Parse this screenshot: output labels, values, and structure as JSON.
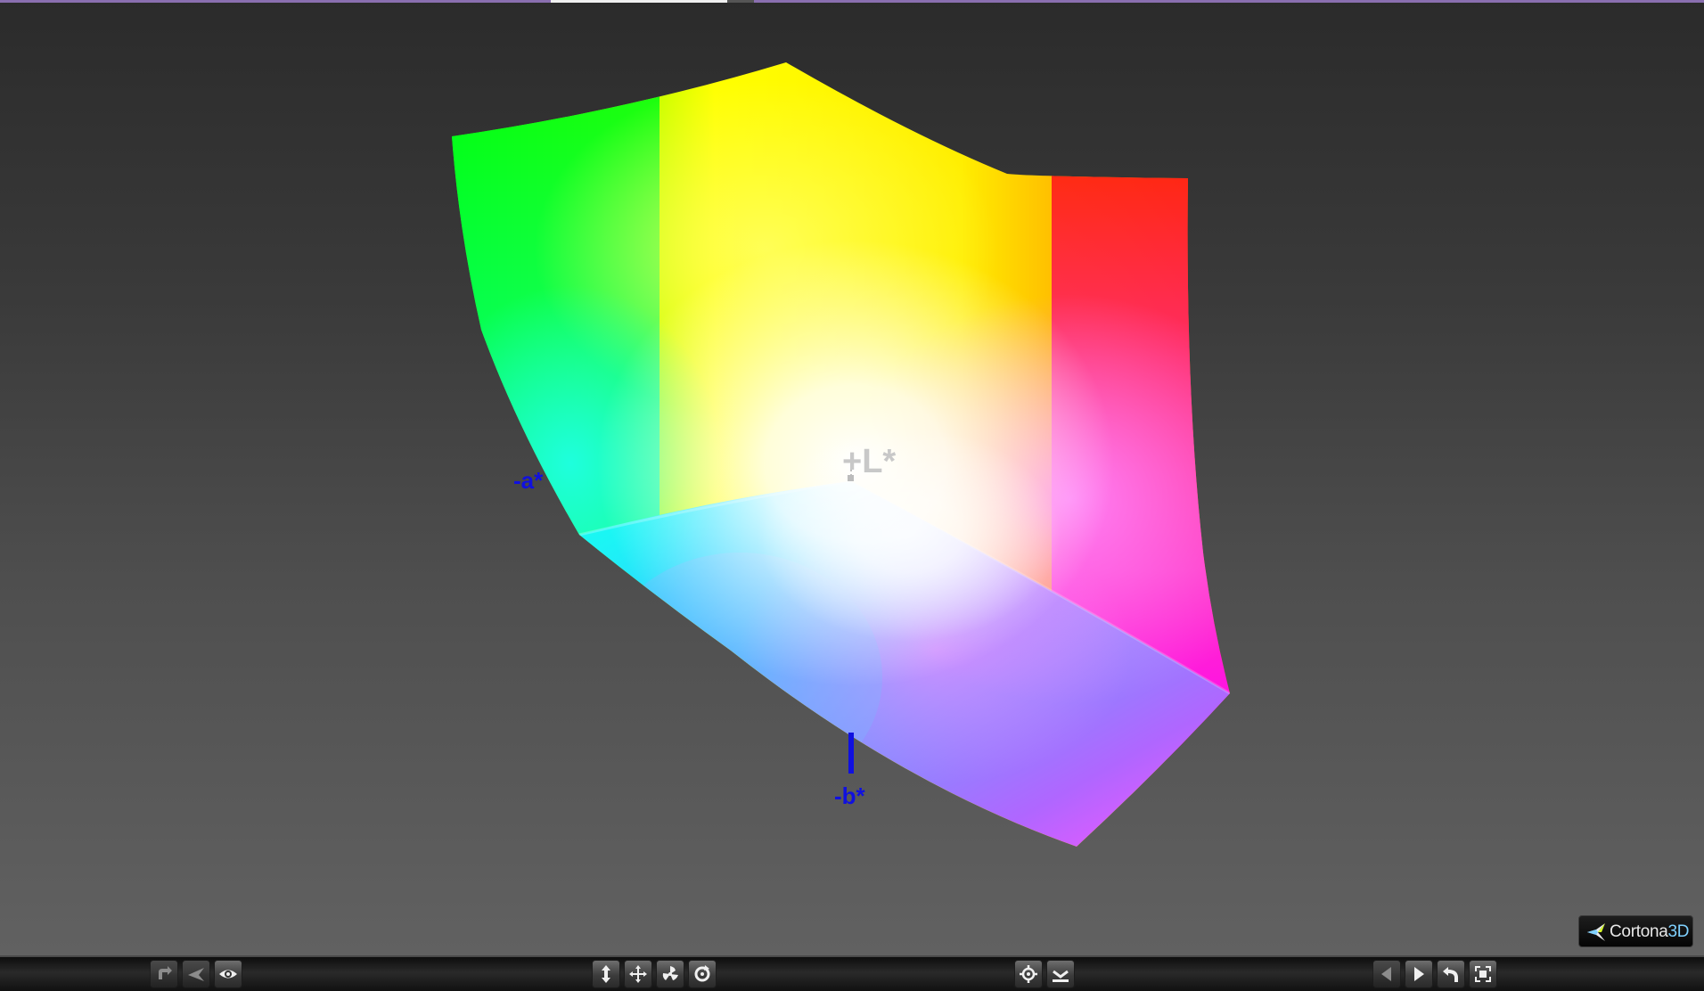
{
  "viewer": {
    "axis_labels": {
      "neg_a": "-a*",
      "neg_b": "-b*",
      "pos_l": "+L*"
    },
    "logo": {
      "text": "Cortona",
      "suffix": "3D"
    },
    "colors": {
      "axis_blue": "#1010e0",
      "background_top": "#2b2b2b",
      "background_bottom": "#636363"
    }
  },
  "toolbar": {
    "left_group": [
      {
        "icon": "pan-arrow-icon",
        "enabled": false
      },
      {
        "icon": "fly-icon",
        "enabled": false
      },
      {
        "icon": "eye-icon",
        "enabled": true
      }
    ],
    "center_group": [
      {
        "icon": "elevate-arrows-icon",
        "enabled": true
      },
      {
        "icon": "move-crosshair-icon",
        "enabled": true
      },
      {
        "icon": "roll-fan-icon",
        "enabled": true
      },
      {
        "icon": "rotate-icon",
        "enabled": true
      }
    ],
    "right_center_group": [
      {
        "icon": "target-icon",
        "enabled": true
      },
      {
        "icon": "straighten-icon",
        "enabled": true
      }
    ],
    "right_group": [
      {
        "icon": "previous-viewpoint-icon",
        "enabled": false
      },
      {
        "icon": "next-viewpoint-icon",
        "enabled": true
      },
      {
        "icon": "restore-icon",
        "enabled": true
      },
      {
        "icon": "fit-icon",
        "enabled": true
      }
    ]
  }
}
